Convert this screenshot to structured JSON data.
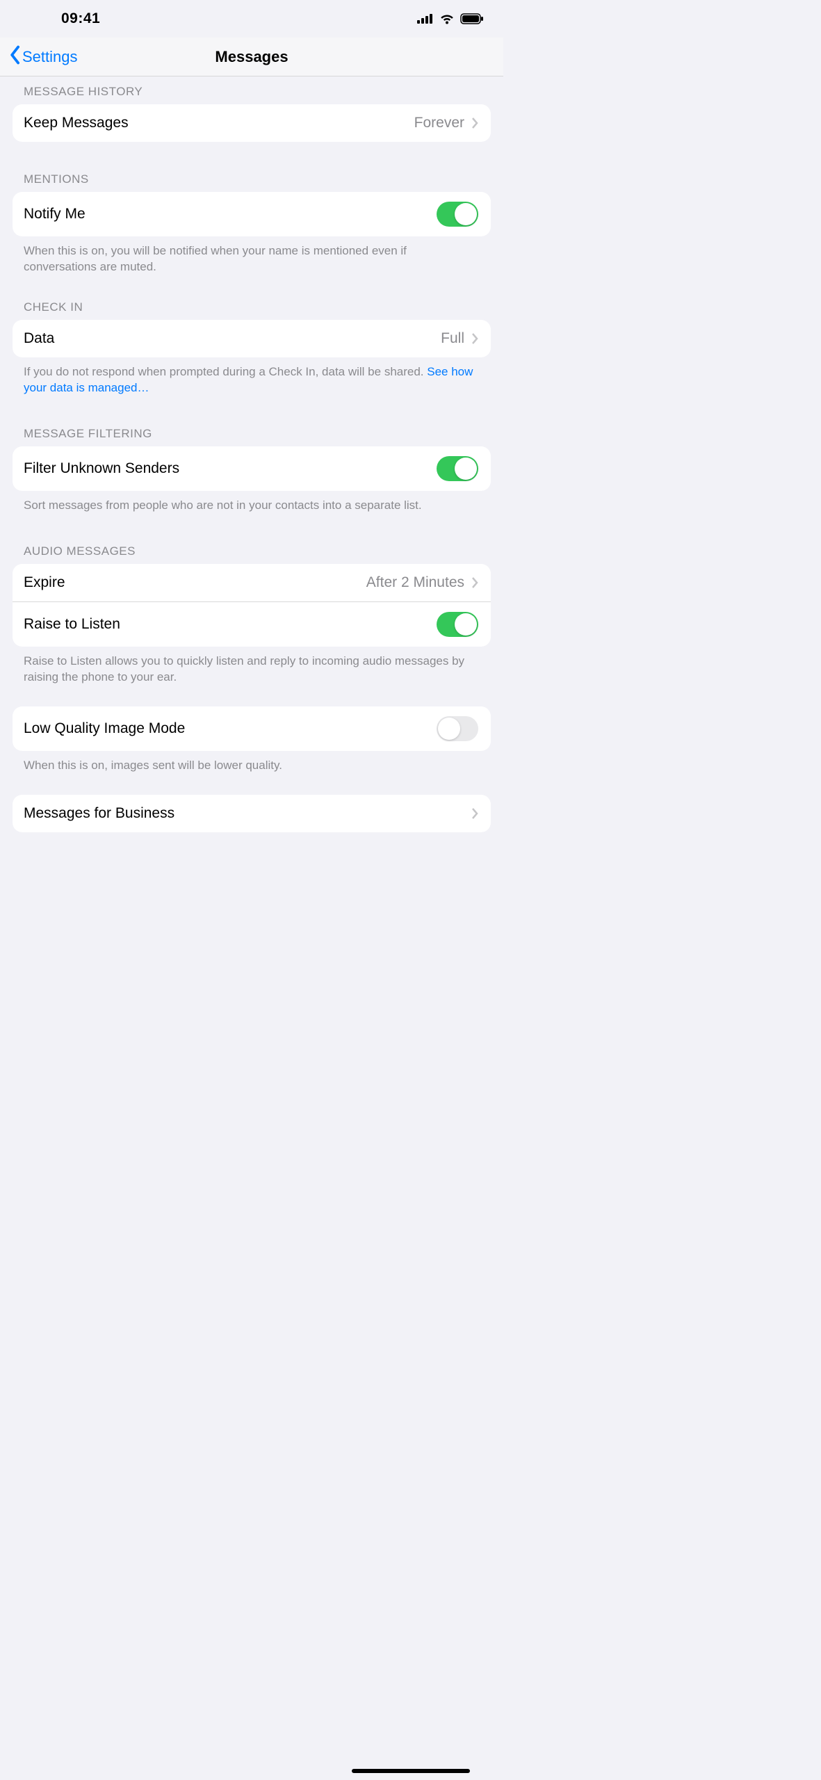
{
  "status": {
    "time": "09:41"
  },
  "nav": {
    "back_label": "Settings",
    "title": "Messages"
  },
  "sections": {
    "message_history": {
      "header": "MESSAGE HISTORY",
      "keep_label": "Keep Messages",
      "keep_value": "Forever"
    },
    "mentions": {
      "header": "MENTIONS",
      "notify_label": "Notify Me",
      "notify_on": true,
      "footer": "When this is on, you will be notified when your name is mentioned even if conversations are muted."
    },
    "check_in": {
      "header": "CHECK IN",
      "data_label": "Data",
      "data_value": "Full",
      "footer_text": "If you do not respond when prompted during a Check In, data will be shared. ",
      "footer_link": "See how your data is managed…"
    },
    "filtering": {
      "header": "MESSAGE FILTERING",
      "filter_label": "Filter Unknown Senders",
      "filter_on": true,
      "footer": "Sort messages from people who are not in your contacts into a separate list."
    },
    "audio": {
      "header": "AUDIO MESSAGES",
      "expire_label": "Expire",
      "expire_value": "After 2 Minutes",
      "raise_label": "Raise to Listen",
      "raise_on": true,
      "footer": "Raise to Listen allows you to quickly listen and reply to incoming audio messages by raising the phone to your ear."
    },
    "low_quality": {
      "label": "Low Quality Image Mode",
      "on": false,
      "footer": "When this is on, images sent will be lower quality."
    },
    "business": {
      "label": "Messages for Business"
    }
  }
}
